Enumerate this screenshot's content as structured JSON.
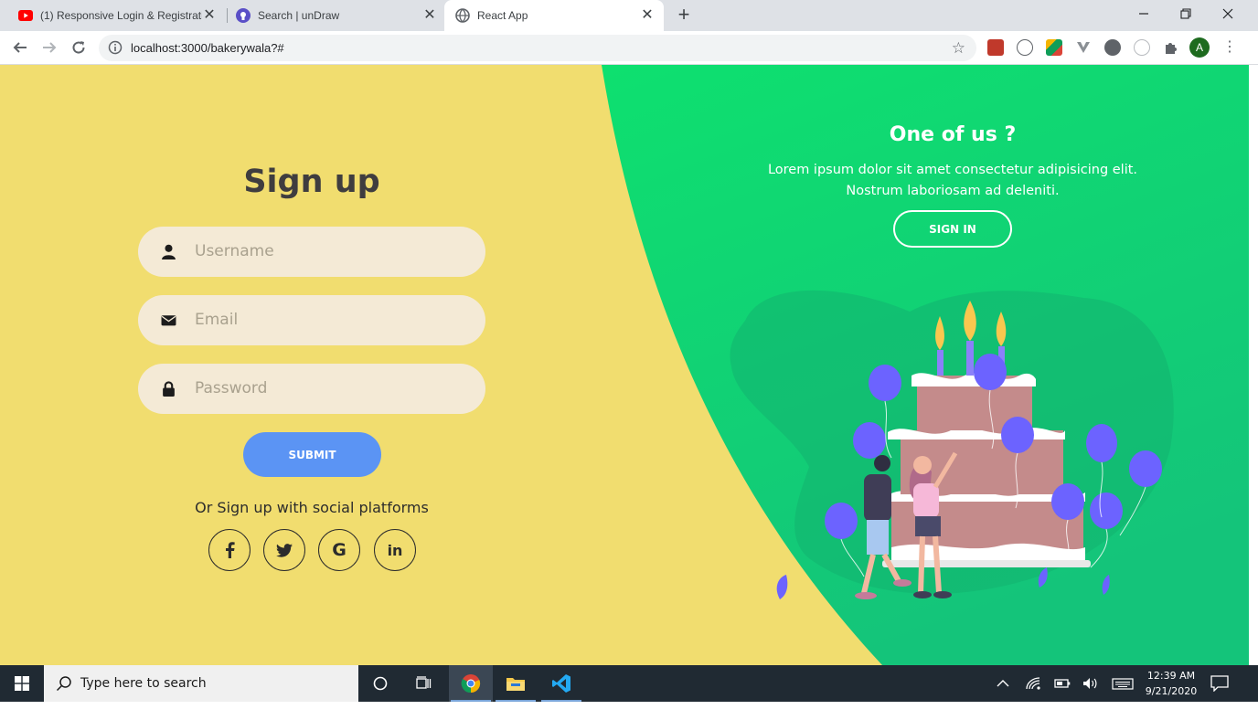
{
  "browser": {
    "tabs": [
      {
        "title": "(1) Responsive Login & Registrati",
        "icon": "youtube-icon",
        "active": false
      },
      {
        "title": "Search | unDraw",
        "icon": "undraw-icon",
        "active": false
      },
      {
        "title": "React App",
        "icon": "globe-icon",
        "active": true
      }
    ],
    "close_glyph": "✕",
    "new_tab_glyph": "+",
    "url": "localhost:3000/bakerywala?#",
    "avatar_letter": "A",
    "window_controls": [
      "minimize-icon",
      "restore-icon",
      "close-icon"
    ]
  },
  "signup": {
    "title": "Sign up",
    "username_placeholder": "Username",
    "email_placeholder": "Email",
    "password_placeholder": "Password",
    "submit_label": "SUBMIT",
    "social_text": "Or Sign up with social platforms",
    "social": [
      {
        "name": "facebook-icon",
        "glyph": "f"
      },
      {
        "name": "twitter-icon",
        "glyph": "t"
      },
      {
        "name": "google-icon",
        "glyph": "G"
      },
      {
        "name": "linkedin-icon",
        "glyph": "in"
      }
    ]
  },
  "panel": {
    "title": "One of us ?",
    "text": "Lorem ipsum dolor sit amet consectetur adipisicing elit. Nostrum laboriosam ad deleniti.",
    "signin_label": "SIGN IN"
  },
  "colors": {
    "yellow": "#f1dd6f",
    "green_top": "#0ee06f",
    "green_bottom": "#12c878",
    "input_bg": "#f4ead6",
    "submit_blue": "#5b94f4",
    "balloon": "#6c63ff",
    "cake": "#c48b8b"
  },
  "taskbar": {
    "search_placeholder": "Type here to search",
    "time": "12:39 AM",
    "date": "9/21/2020",
    "pinned": [
      "cortana-icon",
      "task-view-icon",
      "chrome-icon",
      "file-explorer-icon",
      "vscode-icon"
    ]
  }
}
